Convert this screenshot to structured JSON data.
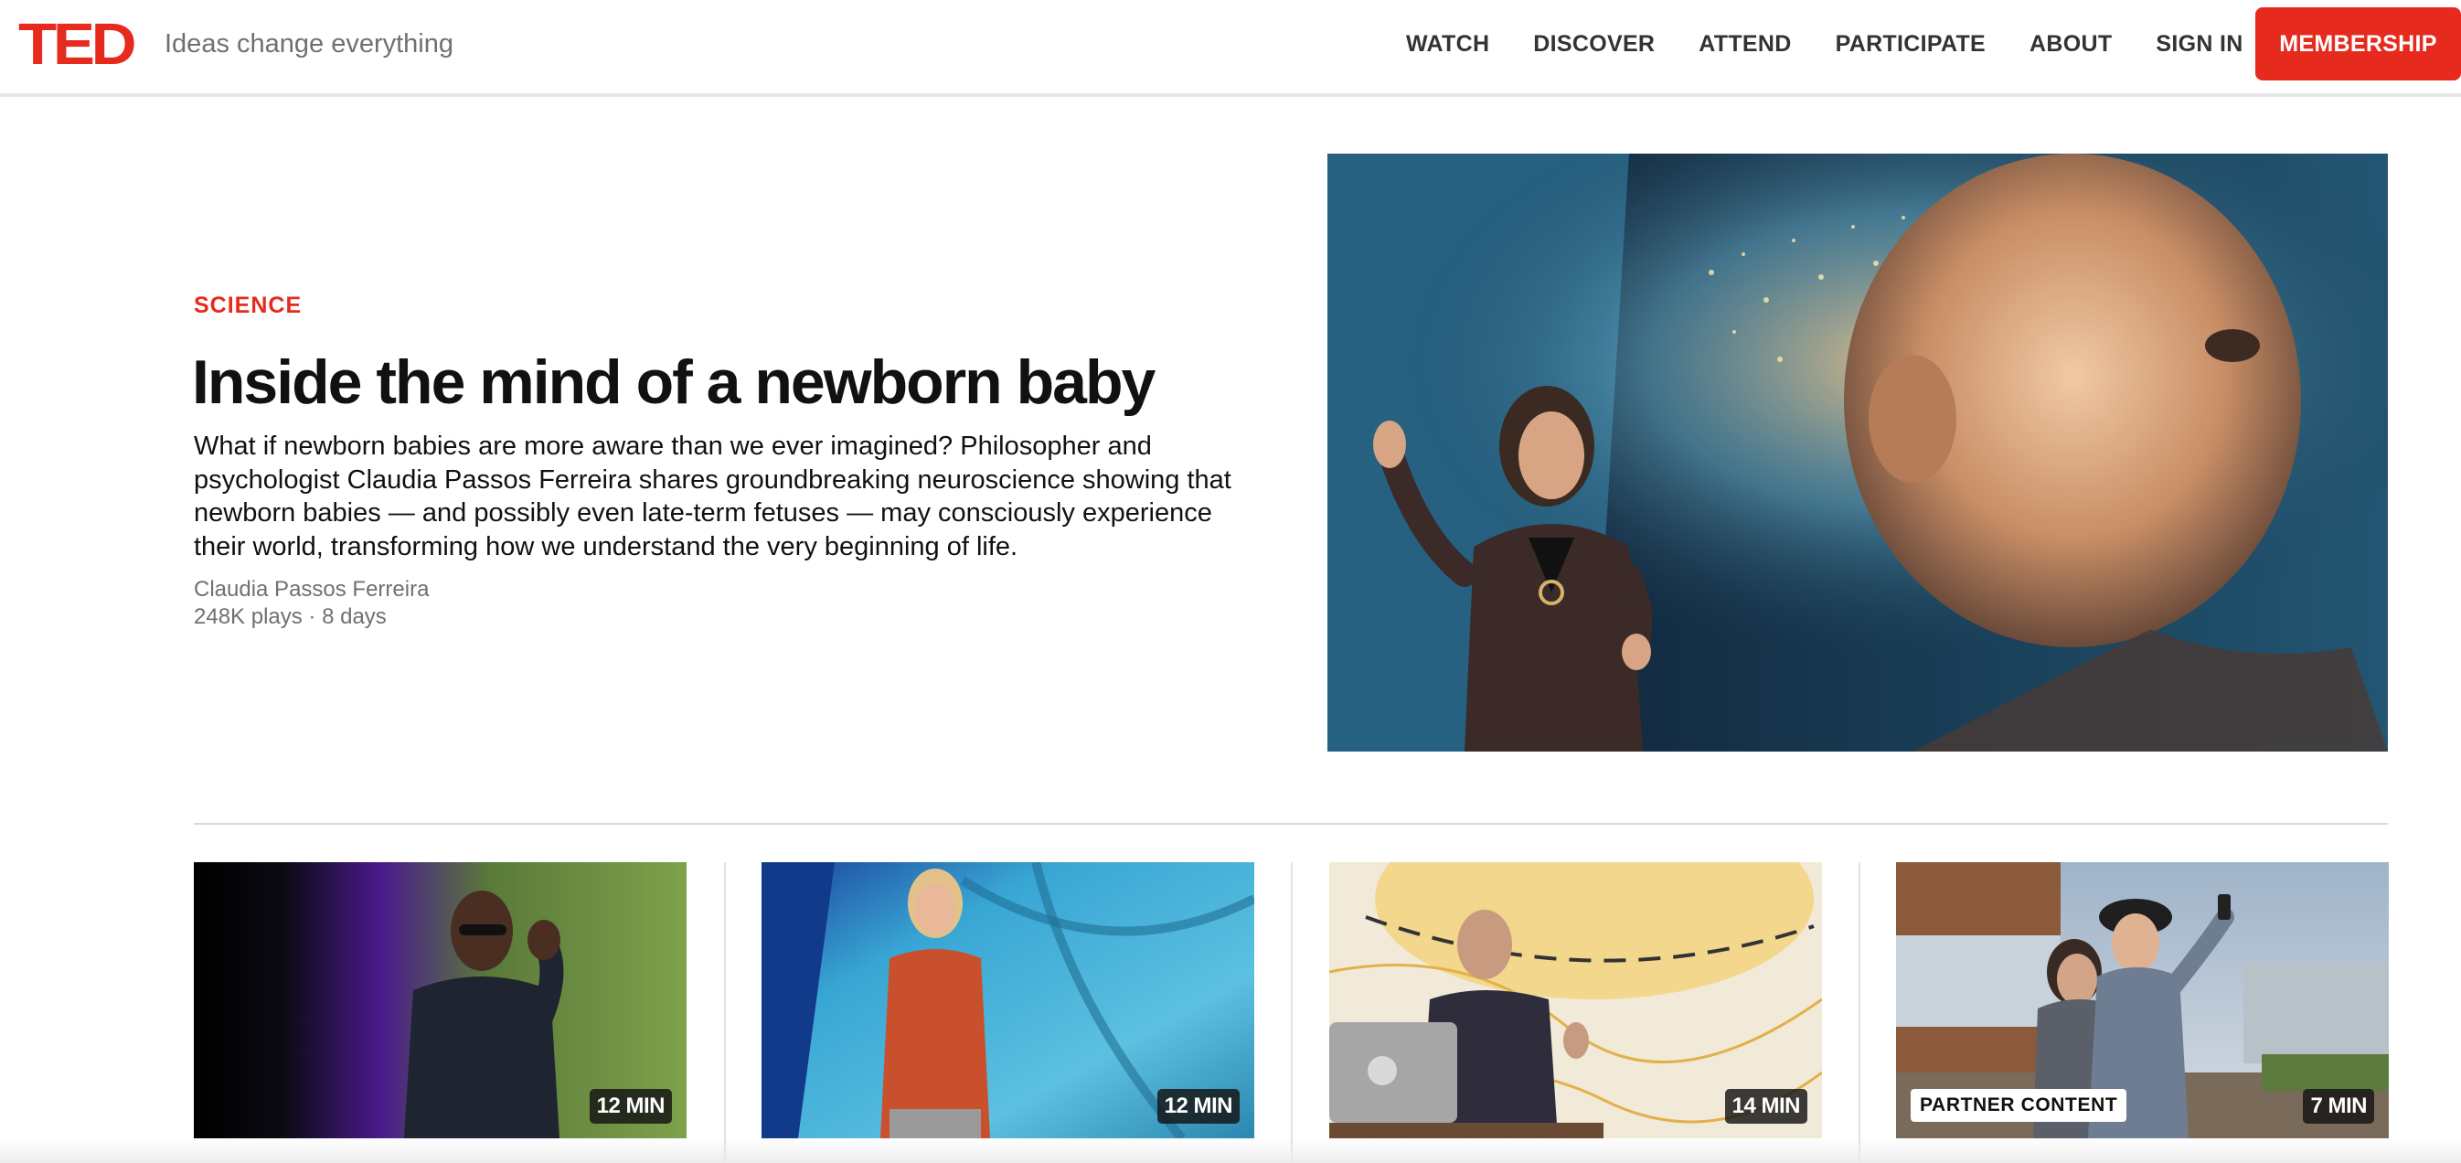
{
  "header": {
    "logo": "TED",
    "tagline": "Ideas change everything",
    "nav": [
      "WATCH",
      "DISCOVER",
      "ATTEND",
      "PARTICIPATE",
      "ABOUT",
      "SIGN IN"
    ],
    "membership_label": "MEMBERSHIP"
  },
  "hero": {
    "category": "SCIENCE",
    "title": "Inside the mind of a newborn baby",
    "description": "What if newborn babies are more aware than we ever imagined? Philosopher and psychologist Claudia Passos Ferreira shares groundbreaking neuroscience showing that newborn babies — and possibly even late-term fetuses — may consciously experience their world, transforming how we understand the very beginning of life.",
    "speaker": "Claudia Passos Ferreira",
    "stats": "248K plays · 8 days"
  },
  "cards": [
    {
      "duration": "12 MIN"
    },
    {
      "duration": "12 MIN"
    },
    {
      "duration": "14 MIN"
    },
    {
      "duration": "7 MIN",
      "badge": "PARTNER CONTENT"
    }
  ],
  "colors": {
    "brand": "#e62b1e",
    "text": "#111111",
    "muted": "#707070"
  }
}
